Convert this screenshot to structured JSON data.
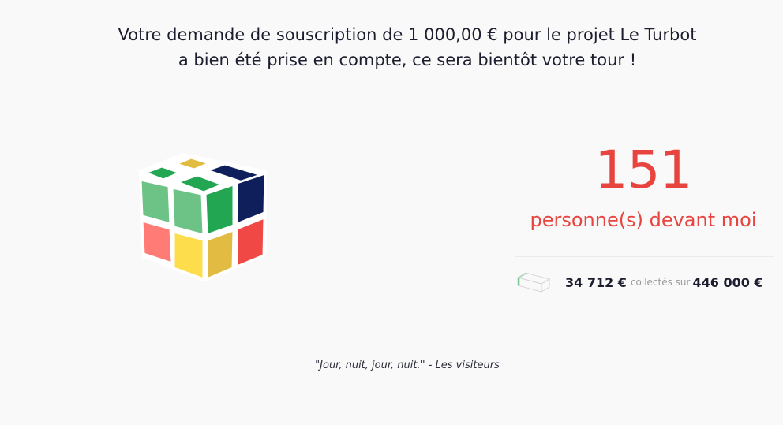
{
  "confirmation": {
    "line1": "Votre demande de souscription de 1 000,00 € pour le projet Le Turbot",
    "line2": "a bien été prise en compte, ce sera bientôt votre tour !"
  },
  "queue": {
    "count": "151",
    "label": "personne(s) devant moi"
  },
  "funding": {
    "collected": "34 712 €",
    "separator": "collectés sur",
    "goal": "446 000 €",
    "icon": "progress-box-icon",
    "progress_fraction": 0.078
  },
  "quote": {
    "text": "\"Jour, nuit, jour, nuit.\" - Les visiteurs"
  },
  "illustration": {
    "icon": "rubiks-cube-icon",
    "colors": {
      "green": "#22a651",
      "light_green": "#6cc385",
      "navy": "#0f1f5c",
      "mustard": "#e2bb42",
      "yellow": "#fedd4c",
      "salmon": "#ff7b76",
      "red": "#f04845"
    }
  },
  "colors": {
    "accent": "#e8443f",
    "text": "#1c1d2e",
    "muted": "#9a9a9a",
    "background": "#f9f9f9"
  }
}
